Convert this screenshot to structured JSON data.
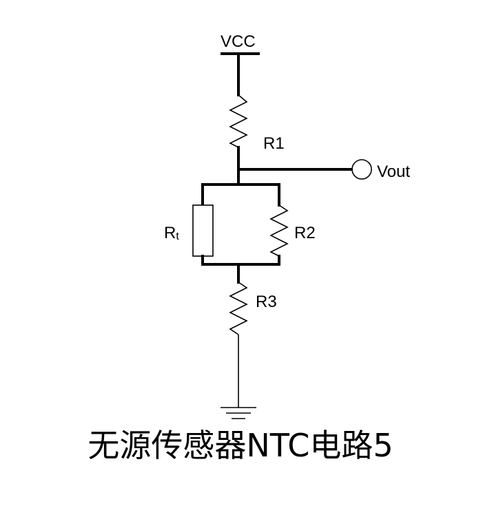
{
  "diagram": {
    "supply_label": "VCC",
    "r1_label": "R1",
    "output_label": "Vout",
    "rt_label_main": "R",
    "rt_label_sub": "t",
    "r2_label": "R2",
    "r3_label": "R3",
    "caption": "无源传感器NTC电路5"
  },
  "colors": {
    "ink": "#000000",
    "background": "#ffffff"
  }
}
